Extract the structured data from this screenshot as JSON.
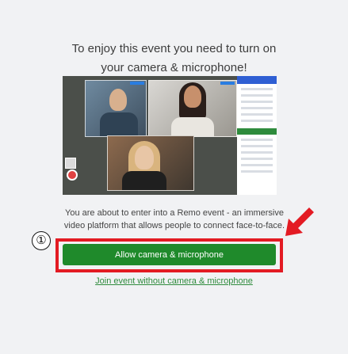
{
  "heading": {
    "line1": "To enjoy this event you need to turn on",
    "line2": "your camera & microphone!"
  },
  "description": {
    "line1": "You are about to enter into a Remo event - an immersive",
    "line2": "video platform that allows people to connect face-to-face."
  },
  "step_marker": "①",
  "allow_button": "Allow camera & microphone",
  "join_link": "Join event without camera & microphone",
  "colors": {
    "primary_green": "#1f8a2b",
    "highlight_red": "#e31b23",
    "link_green": "#2e8b3c",
    "background": "#f1f2f4"
  }
}
